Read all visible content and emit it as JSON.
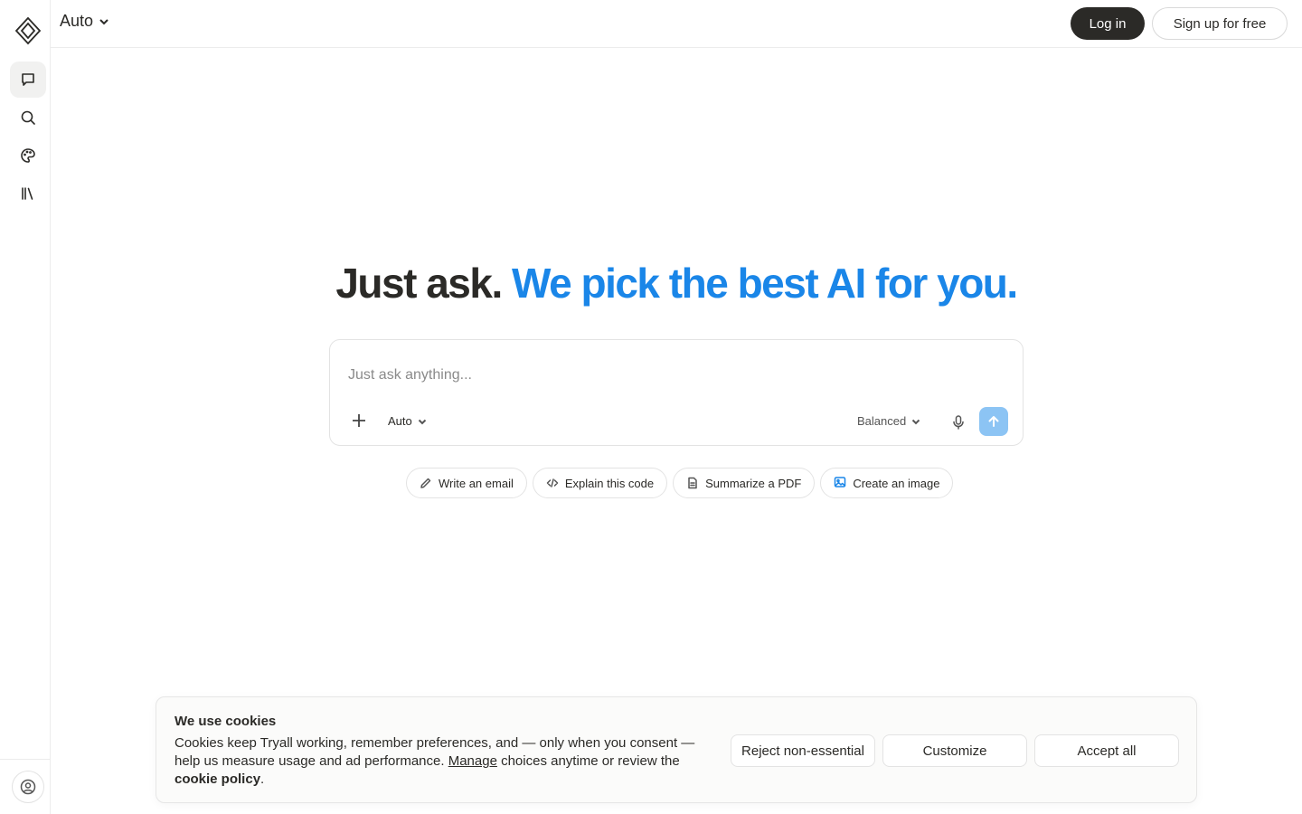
{
  "header": {
    "model_label": "Auto",
    "login_label": "Log in",
    "signup_label": "Sign up for free"
  },
  "sidebar": {
    "items": [
      {
        "name": "chat",
        "icon": "chat-icon"
      },
      {
        "name": "search",
        "icon": "search-icon"
      },
      {
        "name": "palette",
        "icon": "palette-icon"
      },
      {
        "name": "library",
        "icon": "library-icon"
      }
    ],
    "profile_icon": "user-circle-icon"
  },
  "hero": {
    "part1": "Just ask.",
    "part2": "We pick the best AI for you."
  },
  "composer": {
    "placeholder": "Just ask anything...",
    "model_label": "Auto",
    "mode_label": "Balanced"
  },
  "chips": [
    {
      "label": "Write an email",
      "icon": "pencil-icon"
    },
    {
      "label": "Explain this code",
      "icon": "code-icon"
    },
    {
      "label": "Summarize a PDF",
      "icon": "document-icon"
    },
    {
      "label": "Create an image",
      "icon": "image-icon"
    }
  ],
  "cookie": {
    "title": "We use cookies",
    "text_before": "Cookies keep Tryall working, remember preferences, and — only when you consent — help us measure usage and ad performance. ",
    "manage_link": "Manage",
    "text_after": " choices anytime or review the ",
    "policy_link": "cookie policy",
    "text_end": ".",
    "reject_label": "Reject non-essential",
    "customize_label": "Customize",
    "accept_label": "Accept all"
  },
  "colors": {
    "accent": "#1a86e8",
    "dark": "#2b2a27",
    "send_button": "#8cc4f4"
  }
}
